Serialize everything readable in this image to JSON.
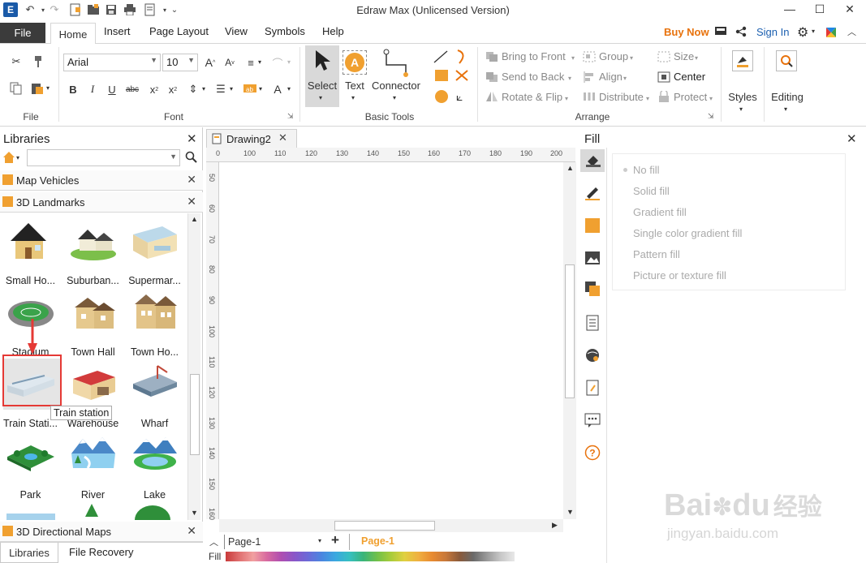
{
  "titlebar": {
    "title": "Edraw Max (Unlicensed Version)"
  },
  "menu": {
    "file": "File",
    "tabs": [
      "Home",
      "Insert",
      "Page Layout",
      "View",
      "Symbols",
      "Help"
    ],
    "buy_now": "Buy Now",
    "sign_in": "Sign In"
  },
  "ribbon": {
    "font_name": "Arial",
    "font_size": "10",
    "groups": {
      "file": "File",
      "font": "Font",
      "basic_tools": "Basic Tools",
      "arrange": "Arrange"
    },
    "tools": {
      "select": "Select",
      "text": "Text",
      "connector": "Connector"
    },
    "arrange": {
      "bring_to_front": "Bring to Front",
      "send_to_back": "Send to Back",
      "rotate_flip": "Rotate & Flip",
      "group": "Group",
      "align": "Align",
      "distribute": "Distribute",
      "size": "Size",
      "center": "Center",
      "protect": "Protect"
    },
    "styles": "Styles",
    "editing": "Editing"
  },
  "libraries": {
    "title": "Libraries",
    "search_value": "",
    "sections": [
      "Map Vehicles",
      "3D Landmarks"
    ],
    "shapes": [
      "Small Ho...",
      "Suburban...",
      "Supermar...",
      "Stadium",
      "Town Hall",
      "Town Ho...",
      "Train Stati...",
      "Warehouse",
      "Wharf",
      "Park",
      "River",
      "Lake"
    ],
    "tooltip": "Train station",
    "bottom_section": "3D Directional Maps",
    "tabs": [
      "Libraries",
      "File Recovery"
    ]
  },
  "document": {
    "tab": "Drawing2",
    "hruler": [
      "0",
      "100",
      "110",
      "120",
      "130",
      "140",
      "150",
      "160",
      "170",
      "180",
      "190",
      "200"
    ],
    "vruler": [
      "50",
      "60",
      "70",
      "80",
      "90",
      "100",
      "110",
      "120",
      "130",
      "140",
      "150",
      "160"
    ],
    "page_select": "Page-1",
    "page_tab": "Page-1",
    "fill_label": "Fill"
  },
  "fill_panel": {
    "title": "Fill",
    "options": [
      "No fill",
      "Solid fill",
      "Gradient fill",
      "Single color gradient fill",
      "Pattern fill",
      "Picture or texture fill"
    ]
  },
  "watermark": {
    "brand": "Bai",
    "du": "du",
    "cn": "经验",
    "url": "jingyan.baidu.com"
  },
  "colors": {
    "accent": "#f0a030",
    "file_tab": "#3b3b3b",
    "highlight": "#e53935",
    "link": "#1b5fb0"
  }
}
